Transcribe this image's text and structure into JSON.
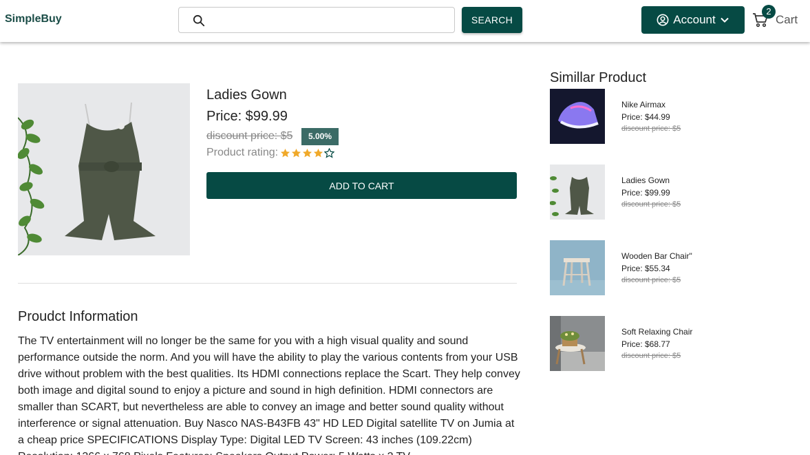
{
  "header": {
    "brand": "SimpleBuy",
    "search_placeholder": "",
    "search_button": "SEARCH",
    "account_label": "Account",
    "cart_count": "2",
    "cart_label": "Cart"
  },
  "product": {
    "name": "Ladies Gown",
    "price": "Price: $99.99",
    "discount": "discount price: $5",
    "discount_pct": "5.00%",
    "rating_label": "Product rating:",
    "rating": 4,
    "rating_max": 5,
    "add_to_cart": "ADD TO CART",
    "image_icon": "romper-image"
  },
  "info": {
    "title": "Proudct Information",
    "text": "The TV entertainment will no longer be the same for you with a high visual quality and sound performance outside the norm. And you will have the ability to play the various contents from your USB drive without problem with the best qualities. Its HDMI connections replace the Scart. They help convey both image and digital sound to enjoy a picture and sound in high definition. HDMI connectors are smaller than SCART, but nevertheless are able to convey an image and better sound quality without interference or signal attenuation. Buy Nasco NAS-B43FB 43\" HD LED Digital satellite TV on Jumia at a cheap price SPECIFICATIONS Display Type: Digital LED TV Screen: 43 inches (109.22cm) Resolution: 1366 x 768 Pixels Features: Speakers Output Power: 5 Watts x 2 TV"
  },
  "similar": {
    "title": "Simillar Product",
    "items": [
      {
        "name": "Nike Airmax",
        "price": "Price: $44.99",
        "discount": "discount price: $5",
        "image": "sneaker-image"
      },
      {
        "name": "Ladies Gown",
        "price": "Price: $99.99",
        "discount": "discount price: $5",
        "image": "romper-image"
      },
      {
        "name": "Wooden Bar Chair\"",
        "price": "Price: $55.34",
        "discount": "discount price: $5",
        "image": "stool-image"
      },
      {
        "name": "Soft Relaxing Chair",
        "price": "Price: $68.77",
        "discount": "discount price: $5",
        "image": "chair-image"
      }
    ]
  },
  "colors": {
    "primary": "#064a44",
    "badge": "#3b6b66",
    "star": "#f0a92a"
  }
}
